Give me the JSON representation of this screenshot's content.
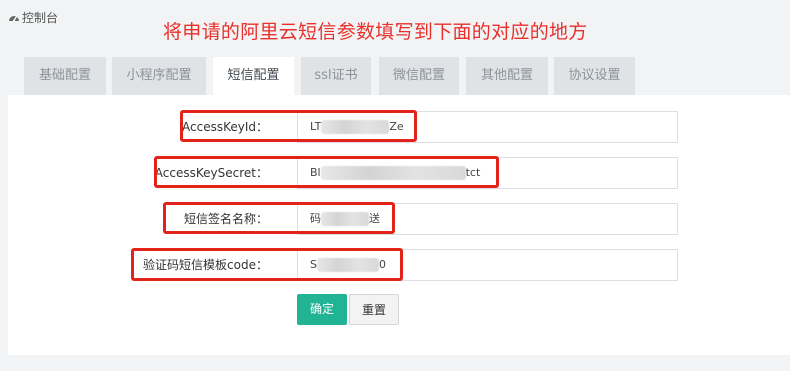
{
  "header": {
    "title": "控制台",
    "icon": "dashboard-icon",
    "annotation": "将申请的阿里云短信参数填写到下面的对应的地方",
    "annotation_color": "#e9302b"
  },
  "tabs": [
    {
      "label": "基础配置",
      "active": false
    },
    {
      "label": "小程序配置",
      "active": false
    },
    {
      "label": "短信配置",
      "active": true
    },
    {
      "label": "ssl证书",
      "active": false
    },
    {
      "label": "微信配置",
      "active": false
    },
    {
      "label": "其他配置",
      "active": false
    },
    {
      "label": "协议设置",
      "active": false
    }
  ],
  "form": {
    "fields": [
      {
        "label": "AccessKeyId：",
        "value_start": "LT",
        "value_end": "Ze"
      },
      {
        "label": "AccessKeySecret：",
        "value_start": "Bl",
        "value_end": "tct"
      },
      {
        "label": "短信签名名称：",
        "value_start": "码",
        "value_end": "送"
      },
      {
        "label": "验证码短信模板code：",
        "value_start": "S",
        "value_end": "0"
      }
    ],
    "confirm_label": "确定",
    "reset_label": "重置"
  },
  "colors": {
    "accent": "#20b394",
    "highlight_box": "#e2231a",
    "tab_inactive": "#dfe3e6"
  }
}
